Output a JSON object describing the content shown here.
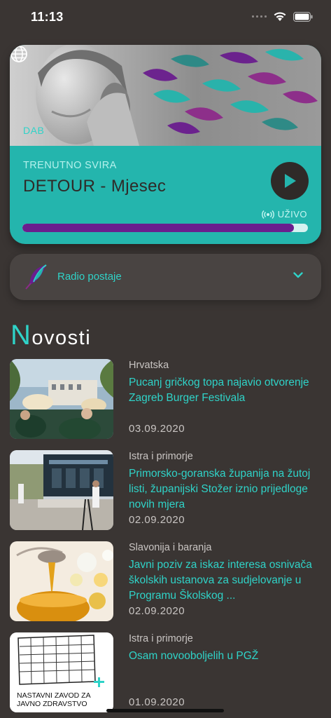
{
  "status_bar": {
    "time": "11:13"
  },
  "player": {
    "band_label": "DAB",
    "now_playing_label": "TRENUTNO SVIRA",
    "track": "DETOUR - Mjesec",
    "live_label": "UŽIVO",
    "progress": 0.95,
    "accent": "#24b5ad",
    "progress_color": "#6a1d8e"
  },
  "stations": {
    "label": "Radio postaje"
  },
  "news": {
    "heading_initial": "N",
    "heading_rest": "ovosti",
    "items": [
      {
        "category": "Hrvatska",
        "title": "Pucanj gričkog topa najavio otvorenje Zagreb Burger Festivala",
        "date": "03.09.2020"
      },
      {
        "category": "Istra i primorje",
        "title": "Primorsko-goranska županija na žutoj listi, županijski Stožer iznio prijedloge novih mjera",
        "date": "02.09.2020"
      },
      {
        "category": "Slavonija i baranja",
        "title": "Javni poziv za iskaz interesa osnivača školskih ustanova za sudjelovanje u Programu Školskog ...",
        "date": "02.09.2020"
      },
      {
        "category": "Istra i primorje",
        "title": "Osam novooboljelih u PGŽ",
        "date": "01.09.2020",
        "thumb_caption": "NASTAVNI ZAVOD ZA JAVNO ZDRAVSTVO"
      }
    ]
  },
  "icons": [
    "wifi-icon",
    "battery-icon",
    "globe-icon",
    "play-icon",
    "broadcast-icon",
    "feather-icon",
    "chevron-down-icon"
  ]
}
